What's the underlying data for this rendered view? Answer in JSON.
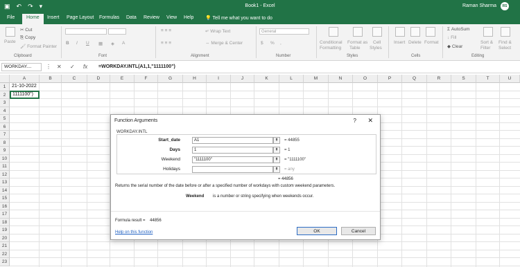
{
  "titlebar": {
    "document_title": "Book1 - Excel",
    "user_name": "Raman Sharma",
    "user_initials": "RS",
    "file_tab": "File"
  },
  "tabs": [
    "Home",
    "Insert",
    "Page Layout",
    "Formulas",
    "Data",
    "Review",
    "View",
    "Help"
  ],
  "tell_me": "Tell me what you want to do",
  "ribbon": {
    "clipboard": {
      "paste": "Paste",
      "cut": "Cut",
      "copy": "Copy",
      "format_painter": "Format Painter",
      "label": "Clipboard"
    },
    "font": {
      "label": "Font",
      "bold": "B",
      "italic": "I",
      "underline": "U"
    },
    "alignment": {
      "wrap_text": "Wrap Text",
      "merge_center": "Merge & Center",
      "label": "Alignment"
    },
    "number": {
      "format_value": "General",
      "percent": "%",
      "label": "Number"
    },
    "styles": {
      "conditional": "Conditional",
      "formatting": "Formatting",
      "format_as": "Format as",
      "table": "Table",
      "cell": "Cell",
      "styles_btn": "Styles",
      "label": "Styles"
    },
    "cells": {
      "insert": "Insert",
      "delete": "Delete",
      "format": "Format",
      "label": "Cells"
    },
    "editing": {
      "autosum": "AutoSum",
      "fill": "Fill",
      "clear": "Clear",
      "sort_filter_1": "Sort &",
      "sort_filter_2": "Filter",
      "find_select_1": "Find &",
      "find_select_2": "Select",
      "label": "Editing"
    }
  },
  "formula_bar": {
    "name_box": "WORKDAY....",
    "cancel": "✕",
    "enter": "✓",
    "fx": "fx",
    "formula": "=WORKDAY.INTL(A1,1,\"1111100\")"
  },
  "columns": [
    "A",
    "B",
    "C",
    "D",
    "E",
    "F",
    "G",
    "H",
    "I",
    "J",
    "K",
    "L",
    "M",
    "N",
    "O",
    "P",
    "Q",
    "R",
    "S",
    "T",
    "U"
  ],
  "rows": [
    "1",
    "2",
    "3",
    "4",
    "5",
    "6",
    "7",
    "8",
    "9",
    "10",
    "11",
    "12",
    "13",
    "14",
    "15",
    "16",
    "17",
    "18",
    "19",
    "20",
    "21",
    "22",
    "23"
  ],
  "cells": {
    "A1": "21-10-2022",
    "A2": "1111100\")"
  },
  "dialog": {
    "title": "Function Arguments",
    "help": "?",
    "close": "✕",
    "function_name": "WORKDAY.INTL",
    "args": [
      {
        "label": "Start_date",
        "value": "A1",
        "result": "=  44855",
        "bold": true
      },
      {
        "label": "Days",
        "value": "1",
        "result": "=  1",
        "bold": true
      },
      {
        "label": "Weekend",
        "value": "\"1111100\"",
        "result": "=  \"1111100\"",
        "bold": false
      },
      {
        "label": "Holidays",
        "value": "",
        "result": "=  any",
        "bold": false
      }
    ],
    "formula_value": "=  44856",
    "description": "Returns the serial number of the date before or after a specified number of workdays with custom weekend parameters.",
    "param_name": "Weekend",
    "param_desc": "is a number or string specifying when weekends occur.",
    "formula_result_label": "Formula result =",
    "formula_result_value": "44856",
    "help_link": "Help on this function",
    "ok": "OK",
    "cancel": "Cancel"
  }
}
